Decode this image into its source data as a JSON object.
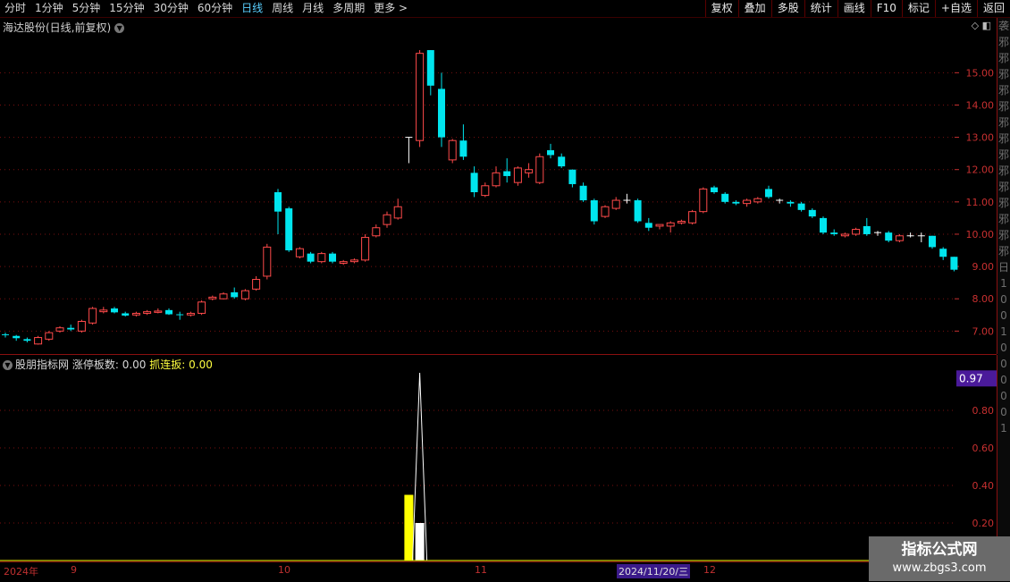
{
  "toolbar": {
    "period_tabs": [
      "分时",
      "1分钟",
      "5分钟",
      "15分钟",
      "30分钟",
      "60分钟",
      "日线",
      "周线",
      "月线",
      "多周期",
      "更多 >"
    ],
    "active_tab": "日线",
    "tool_buttons": [
      "复权",
      "叠加",
      "多股",
      "统计",
      "画线",
      "F10",
      "标记",
      "+自选",
      "返回"
    ]
  },
  "main_panel": {
    "title": "海达股份(日线,前复权)",
    "price_axis_labels": [
      "15.00",
      "14.00",
      "13.00",
      "12.00",
      "11.00",
      "10.00",
      "9.00",
      "8.00",
      "7.00"
    ]
  },
  "indicator_panel": {
    "name": "股朋指标网",
    "label1": "涨停板数:",
    "value1": "0.00",
    "label2": "抓连扳:",
    "value2": "0.00",
    "axis_labels": [
      "0.80",
      "0.60",
      "0.40",
      "0.20"
    ],
    "current_value": "0.97"
  },
  "right_strip": {
    "text": "袭邪邪邪邪邪邪邪邪邪邪邪邪邪邪 日1001000001"
  },
  "bottom_axis": {
    "labels": [
      "2024年",
      "9",
      "10",
      "11",
      "12"
    ],
    "cursor_date": "2024/11/20/三"
  },
  "watermark": {
    "title": "指标公式网",
    "url": "www.zbgs3.com"
  },
  "colors": {
    "up": "#ff4a4a",
    "down": "#00e5ee",
    "flat": "#ffffff",
    "grid": "#7a1010",
    "axis_text": "#c83030"
  },
  "chart_data": {
    "type": "candlestick",
    "ylim": [
      6.4,
      16.2
    ],
    "candles": [
      {
        "o": 6.9,
        "h": 6.95,
        "l": 6.8,
        "c": 6.88
      },
      {
        "o": 6.85,
        "h": 6.88,
        "l": 6.7,
        "c": 6.78
      },
      {
        "o": 6.75,
        "h": 6.8,
        "l": 6.65,
        "c": 6.7
      },
      {
        "o": 6.6,
        "h": 6.85,
        "l": 6.58,
        "c": 6.8
      },
      {
        "o": 6.75,
        "h": 7.0,
        "l": 6.7,
        "c": 6.95
      },
      {
        "o": 7.0,
        "h": 7.15,
        "l": 6.95,
        "c": 7.1
      },
      {
        "o": 7.1,
        "h": 7.2,
        "l": 7.0,
        "c": 7.05
      },
      {
        "o": 7.0,
        "h": 7.35,
        "l": 6.95,
        "c": 7.3
      },
      {
        "o": 7.25,
        "h": 7.75,
        "l": 7.2,
        "c": 7.7
      },
      {
        "o": 7.6,
        "h": 7.75,
        "l": 7.55,
        "c": 7.65
      },
      {
        "o": 7.7,
        "h": 7.75,
        "l": 7.55,
        "c": 7.58
      },
      {
        "o": 7.55,
        "h": 7.6,
        "l": 7.45,
        "c": 7.48
      },
      {
        "o": 7.5,
        "h": 7.6,
        "l": 7.45,
        "c": 7.55
      },
      {
        "o": 7.55,
        "h": 7.65,
        "l": 7.5,
        "c": 7.6
      },
      {
        "o": 7.58,
        "h": 7.7,
        "l": 7.55,
        "c": 7.62
      },
      {
        "o": 7.65,
        "h": 7.7,
        "l": 7.5,
        "c": 7.52
      },
      {
        "o": 7.52,
        "h": 7.6,
        "l": 7.35,
        "c": 7.5
      },
      {
        "o": 7.5,
        "h": 7.6,
        "l": 7.45,
        "c": 7.55
      },
      {
        "o": 7.55,
        "h": 7.95,
        "l": 7.5,
        "c": 7.9
      },
      {
        "o": 8.0,
        "h": 8.1,
        "l": 7.95,
        "c": 8.05
      },
      {
        "o": 8.0,
        "h": 8.2,
        "l": 7.98,
        "c": 8.15
      },
      {
        "o": 8.2,
        "h": 8.35,
        "l": 8.0,
        "c": 8.05
      },
      {
        "o": 8.0,
        "h": 8.3,
        "l": 7.95,
        "c": 8.25
      },
      {
        "o": 8.3,
        "h": 8.7,
        "l": 8.25,
        "c": 8.6
      },
      {
        "o": 8.7,
        "h": 9.7,
        "l": 8.6,
        "c": 9.6
      },
      {
        "o": 11.3,
        "h": 11.4,
        "l": 10.0,
        "c": 10.7
      },
      {
        "o": 10.8,
        "h": 10.85,
        "l": 9.45,
        "c": 9.5
      },
      {
        "o": 9.3,
        "h": 9.6,
        "l": 9.25,
        "c": 9.55
      },
      {
        "o": 9.4,
        "h": 9.45,
        "l": 9.1,
        "c": 9.15
      },
      {
        "o": 9.15,
        "h": 9.45,
        "l": 9.1,
        "c": 9.4
      },
      {
        "o": 9.4,
        "h": 9.45,
        "l": 9.1,
        "c": 9.15
      },
      {
        "o": 9.1,
        "h": 9.2,
        "l": 9.05,
        "c": 9.15
      },
      {
        "o": 9.15,
        "h": 9.25,
        "l": 9.1,
        "c": 9.2
      },
      {
        "o": 9.2,
        "h": 10.0,
        "l": 9.15,
        "c": 9.9
      },
      {
        "o": 9.95,
        "h": 10.3,
        "l": 9.9,
        "c": 10.2
      },
      {
        "o": 10.3,
        "h": 10.7,
        "l": 10.2,
        "c": 10.6
      },
      {
        "o": 10.5,
        "h": 11.1,
        "l": 10.45,
        "c": 10.85
      },
      {
        "o": 13.0,
        "h": 13.0,
        "l": 12.2,
        "c": 13.0
      },
      {
        "o": 12.9,
        "h": 15.7,
        "l": 12.7,
        "c": 15.6
      },
      {
        "o": 15.7,
        "h": 15.7,
        "l": 14.3,
        "c": 14.6
      },
      {
        "o": 14.5,
        "h": 15.0,
        "l": 12.7,
        "c": 13.0
      },
      {
        "o": 12.3,
        "h": 12.95,
        "l": 12.2,
        "c": 12.9
      },
      {
        "o": 12.9,
        "h": 13.4,
        "l": 12.3,
        "c": 12.4
      },
      {
        "o": 11.9,
        "h": 12.1,
        "l": 11.15,
        "c": 11.3
      },
      {
        "o": 11.2,
        "h": 11.6,
        "l": 11.15,
        "c": 11.5
      },
      {
        "o": 11.5,
        "h": 12.1,
        "l": 11.45,
        "c": 11.9
      },
      {
        "o": 11.95,
        "h": 12.35,
        "l": 11.6,
        "c": 11.8
      },
      {
        "o": 11.6,
        "h": 12.1,
        "l": 11.5,
        "c": 12.05
      },
      {
        "o": 11.9,
        "h": 12.2,
        "l": 11.75,
        "c": 12.0
      },
      {
        "o": 11.6,
        "h": 12.5,
        "l": 11.55,
        "c": 12.4
      },
      {
        "o": 12.6,
        "h": 12.8,
        "l": 12.35,
        "c": 12.45
      },
      {
        "o": 12.4,
        "h": 12.5,
        "l": 12.05,
        "c": 12.1
      },
      {
        "o": 12.0,
        "h": 12.0,
        "l": 11.45,
        "c": 11.55
      },
      {
        "o": 11.5,
        "h": 11.6,
        "l": 11.0,
        "c": 11.05
      },
      {
        "o": 11.05,
        "h": 11.1,
        "l": 10.3,
        "c": 10.4
      },
      {
        "o": 10.55,
        "h": 10.9,
        "l": 10.5,
        "c": 10.85
      },
      {
        "o": 10.8,
        "h": 11.15,
        "l": 10.75,
        "c": 11.05
      },
      {
        "o": 11.05,
        "h": 11.25,
        "l": 10.95,
        "c": 11.05
      },
      {
        "o": 11.05,
        "h": 11.1,
        "l": 10.35,
        "c": 10.4
      },
      {
        "o": 10.35,
        "h": 10.5,
        "l": 10.1,
        "c": 10.2
      },
      {
        "o": 10.25,
        "h": 10.3,
        "l": 10.15,
        "c": 10.3
      },
      {
        "o": 10.25,
        "h": 10.4,
        "l": 10.05,
        "c": 10.35
      },
      {
        "o": 10.35,
        "h": 10.45,
        "l": 10.3,
        "c": 10.4
      },
      {
        "o": 10.35,
        "h": 10.75,
        "l": 10.3,
        "c": 10.7
      },
      {
        "o": 10.7,
        "h": 11.45,
        "l": 10.65,
        "c": 11.4
      },
      {
        "o": 11.45,
        "h": 11.5,
        "l": 11.25,
        "c": 11.3
      },
      {
        "o": 11.25,
        "h": 11.3,
        "l": 10.95,
        "c": 11.0
      },
      {
        "o": 11.0,
        "h": 11.05,
        "l": 10.9,
        "c": 10.95
      },
      {
        "o": 10.95,
        "h": 11.1,
        "l": 10.85,
        "c": 11.05
      },
      {
        "o": 11.0,
        "h": 11.15,
        "l": 10.95,
        "c": 11.1
      },
      {
        "o": 11.4,
        "h": 11.5,
        "l": 11.1,
        "c": 11.15
      },
      {
        "o": 11.05,
        "h": 11.1,
        "l": 10.95,
        "c": 11.05
      },
      {
        "o": 11.0,
        "h": 11.05,
        "l": 10.85,
        "c": 10.95
      },
      {
        "o": 10.95,
        "h": 11.0,
        "l": 10.7,
        "c": 10.75
      },
      {
        "o": 10.75,
        "h": 10.8,
        "l": 10.5,
        "c": 10.55
      },
      {
        "o": 10.5,
        "h": 10.55,
        "l": 10.0,
        "c": 10.05
      },
      {
        "o": 10.05,
        "h": 10.15,
        "l": 9.95,
        "c": 10.0
      },
      {
        "o": 9.95,
        "h": 10.05,
        "l": 9.9,
        "c": 10.0
      },
      {
        "o": 10.0,
        "h": 10.2,
        "l": 9.95,
        "c": 10.15
      },
      {
        "o": 10.25,
        "h": 10.5,
        "l": 9.95,
        "c": 10.0
      },
      {
        "o": 10.05,
        "h": 10.1,
        "l": 9.95,
        "c": 10.05
      },
      {
        "o": 10.05,
        "h": 10.1,
        "l": 9.75,
        "c": 9.8
      },
      {
        "o": 9.8,
        "h": 10.0,
        "l": 9.75,
        "c": 9.95
      },
      {
        "o": 9.95,
        "h": 10.05,
        "l": 9.9,
        "c": 9.95
      },
      {
        "o": 9.95,
        "h": 10.05,
        "l": 9.75,
        "c": 9.95
      },
      {
        "o": 9.95,
        "h": 9.95,
        "l": 9.55,
        "c": 9.6
      },
      {
        "o": 9.55,
        "h": 9.6,
        "l": 9.2,
        "c": 9.3
      },
      {
        "o": 9.3,
        "h": 9.3,
        "l": 8.85,
        "c": 8.9
      }
    ],
    "indicator": {
      "ylim": [
        0,
        1.0
      ],
      "bars": [
        {
          "index": 37,
          "value": 0.35,
          "color": "#ffff00"
        },
        {
          "index": 38,
          "value": 0.2,
          "color": "#ffffff"
        }
      ],
      "peak": {
        "index": 38,
        "value": 1.0
      }
    }
  }
}
